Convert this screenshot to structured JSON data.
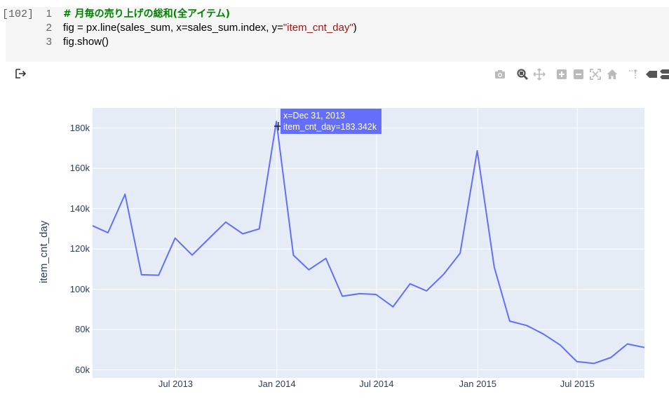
{
  "cell": {
    "execution_count": "[102]",
    "lines": [
      {
        "num": "1",
        "parts": [
          {
            "t": "comment",
            "v": "# 月毎の売り上げの総和(全アイテム)"
          }
        ]
      },
      {
        "num": "2",
        "parts": [
          {
            "t": "code",
            "v": "fig = px.line(sales_sum, x=sales_sum.index, y="
          },
          {
            "t": "str",
            "v": "\"item_cnt_day\""
          },
          {
            "t": "code",
            "v": ")"
          }
        ]
      },
      {
        "num": "3",
        "parts": [
          {
            "t": "code",
            "v": "fig.show()"
          }
        ]
      }
    ]
  },
  "output": {
    "icon": "output-arrow-icon"
  },
  "modebar": {
    "buttons": [
      {
        "name": "camera-icon",
        "title": "Download plot as a png"
      },
      {
        "name": "zoom-icon",
        "title": "Zoom"
      },
      {
        "name": "pan-icon",
        "title": "Pan"
      },
      {
        "name": "zoom-in-icon",
        "title": "Zoom in"
      },
      {
        "name": "zoom-out-icon",
        "title": "Zoom out"
      },
      {
        "name": "autoscale-icon",
        "title": "Autoscale"
      },
      {
        "name": "home-icon",
        "title": "Reset axes"
      },
      {
        "name": "spike-lines-icon",
        "title": "Toggle Spike Lines"
      },
      {
        "name": "hover-closest-icon",
        "title": "Show closest data on hover"
      },
      {
        "name": "hover-compare-icon",
        "title": "Compare data on hover"
      }
    ]
  },
  "hover": {
    "line1": "x=Dec 31, 2013",
    "line2": "item_cnt_day=183.342k"
  },
  "chart_data": {
    "type": "line",
    "title": "",
    "xlabel": "",
    "ylabel": "item_cnt_day",
    "grid": true,
    "line_color": "#636efa",
    "plot_bg": "#e5ecf6",
    "x": [
      "2013-01-31",
      "2013-02-28",
      "2013-03-31",
      "2013-04-30",
      "2013-05-31",
      "2013-06-30",
      "2013-07-31",
      "2013-08-31",
      "2013-09-30",
      "2013-10-31",
      "2013-11-30",
      "2013-12-31",
      "2014-01-31",
      "2014-02-28",
      "2014-03-31",
      "2014-04-30",
      "2014-05-31",
      "2014-06-30",
      "2014-07-31",
      "2014-08-31",
      "2014-09-30",
      "2014-10-31",
      "2014-11-30",
      "2014-12-31",
      "2015-01-31",
      "2015-02-28",
      "2015-03-31",
      "2015-04-30",
      "2015-05-31",
      "2015-06-30",
      "2015-07-31",
      "2015-08-31",
      "2015-09-30",
      "2015-10-31"
    ],
    "y": [
      131479,
      128090,
      147142,
      107190,
      106970,
      125381,
      116966,
      125291,
      133332,
      127541,
      130009,
      183342,
      116899,
      109687,
      115297,
      96556,
      97790,
      97429,
      91280,
      102721,
      99208,
      107422,
      117845,
      168755,
      110971,
      84198,
      82014,
      77827,
      72295,
      64114,
      63187,
      66079,
      72843,
      71056
    ],
    "xrange": [
      "2013-01-31",
      "2015-10-31"
    ],
    "ylim": [
      56000,
      190000
    ],
    "yticks": [
      {
        "value": 60000,
        "label": "60k"
      },
      {
        "value": 80000,
        "label": "80k"
      },
      {
        "value": 100000,
        "label": "100k"
      },
      {
        "value": 120000,
        "label": "120k"
      },
      {
        "value": 140000,
        "label": "140k"
      },
      {
        "value": 160000,
        "label": "160k"
      },
      {
        "value": 180000,
        "label": "180k"
      }
    ],
    "xticks": [
      {
        "value": "2013-07-01",
        "label": "Jul 2013"
      },
      {
        "value": "2014-01-01",
        "label": "Jan 2014"
      },
      {
        "value": "2014-07-01",
        "label": "Jul 2014"
      },
      {
        "value": "2015-01-01",
        "label": "Jan 2015"
      },
      {
        "value": "2015-07-01",
        "label": "Jul 2015"
      }
    ]
  }
}
